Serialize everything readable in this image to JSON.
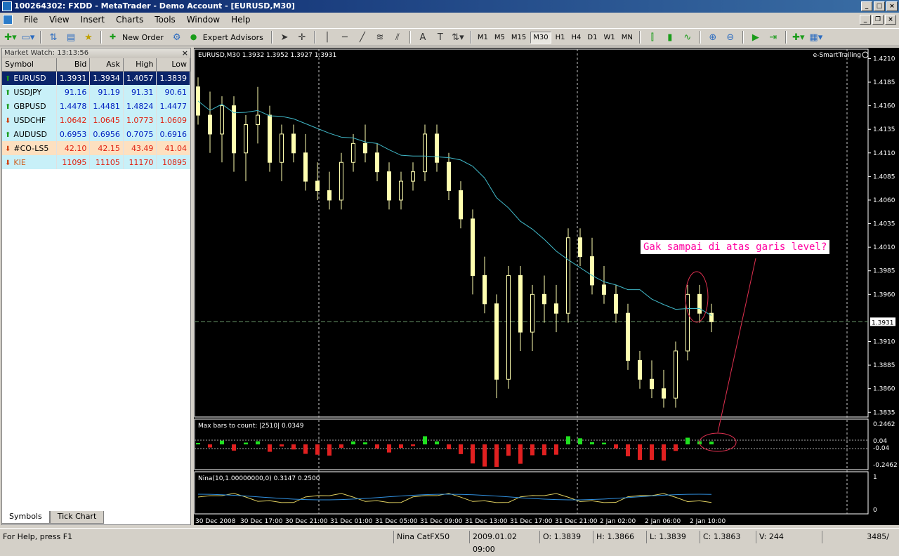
{
  "window": {
    "title": "100264302: FXDD - MetaTrader - Demo Account - [EURUSD,M30]"
  },
  "menu": [
    "File",
    "View",
    "Insert",
    "Charts",
    "Tools",
    "Window",
    "Help"
  ],
  "toolbar": {
    "new_order": "New Order",
    "expert_advisors": "Expert Advisors",
    "timeframes": [
      "M1",
      "M5",
      "M15",
      "M30",
      "H1",
      "H4",
      "D1",
      "W1",
      "MN"
    ],
    "active_timeframe": "M30"
  },
  "market_watch": {
    "title": "Market Watch: 13:13:56",
    "columns": [
      "Symbol",
      "Bid",
      "Ask",
      "High",
      "Low"
    ],
    "rows": [
      {
        "symbol": "EURUSD",
        "bid": "1.3931",
        "ask": "1.3934",
        "high": "1.4057",
        "low": "1.3839",
        "dir": "up"
      },
      {
        "symbol": "USDJPY",
        "bid": "91.16",
        "ask": "91.19",
        "high": "91.31",
        "low": "90.61",
        "dir": "up"
      },
      {
        "symbol": "GBPUSD",
        "bid": "1.4478",
        "ask": "1.4481",
        "high": "1.4824",
        "low": "1.4477",
        "dir": "up"
      },
      {
        "symbol": "USDCHF",
        "bid": "1.0642",
        "ask": "1.0645",
        "high": "1.0773",
        "low": "1.0609",
        "dir": "down"
      },
      {
        "symbol": "AUDUSD",
        "bid": "0.6953",
        "ask": "0.6956",
        "high": "0.7075",
        "low": "0.6916",
        "dir": "up"
      },
      {
        "symbol": "#CO-LS5",
        "bid": "42.10",
        "ask": "42.15",
        "high": "43.49",
        "low": "41.04",
        "dir": "down"
      },
      {
        "symbol": "KIE",
        "bid": "11095",
        "ask": "11105",
        "high": "11170",
        "low": "10895",
        "dir": "down"
      }
    ],
    "tabs": [
      "Symbols",
      "Tick Chart"
    ]
  },
  "chart": {
    "header": "EURUSD,M30  1.3932 1.3952 1.3927 1.3931",
    "ea_label": "e-SmartTrailing",
    "current_price": "1.3931",
    "price_labels": [
      "1.4210",
      "1.4185",
      "1.4160",
      "1.4135",
      "1.4110",
      "1.4085",
      "1.4060",
      "1.4035",
      "1.4010",
      "1.3985",
      "1.3960",
      "1.3910",
      "1.3885",
      "1.3860",
      "1.3835"
    ],
    "callout": "Gak sampai di atas garis level?",
    "indicator1_label": "Max bars to count: |2510|  0.0349",
    "indicator1_scale": [
      "0.2462",
      "0.04",
      "-0.04",
      "-0.2462"
    ],
    "indicator2_label": "Nina(10,1.00000000,0) 0.3147 0.2500",
    "indicator2_scale": [
      "1",
      "0"
    ],
    "time_labels": [
      "30 Dec 2008",
      "30 Dec 17:00",
      "30 Dec 21:00",
      "31 Dec 01:00",
      "31 Dec 05:00",
      "31 Dec 09:00",
      "31 Dec 13:00",
      "31 Dec 17:00",
      "31 Dec 21:00",
      "2 Jan 02:00",
      "2 Jan 06:00",
      "2 Jan 10:00"
    ]
  },
  "chart_data": {
    "type": "candlestick",
    "symbol": "EURUSD",
    "timeframe": "M30",
    "ylim": [
      1.383,
      1.422
    ],
    "candles": [
      [
        1.418,
        1.419,
        1.414,
        1.415
      ],
      [
        1.415,
        1.4175,
        1.411,
        1.413
      ],
      [
        1.413,
        1.417,
        1.41,
        1.416
      ],
      [
        1.416,
        1.417,
        1.409,
        1.411
      ],
      [
        1.411,
        1.415,
        1.408,
        1.414
      ],
      [
        1.414,
        1.418,
        1.412,
        1.415
      ],
      [
        1.415,
        1.416,
        1.409,
        1.41
      ],
      [
        1.41,
        1.414,
        1.408,
        1.413
      ],
      [
        1.413,
        1.414,
        1.41,
        1.411
      ],
      [
        1.411,
        1.413,
        1.407,
        1.408
      ],
      [
        1.408,
        1.41,
        1.406,
        1.407
      ],
      [
        1.407,
        1.409,
        1.405,
        1.406
      ],
      [
        1.406,
        1.411,
        1.405,
        1.41
      ],
      [
        1.41,
        1.413,
        1.409,
        1.412
      ],
      [
        1.412,
        1.414,
        1.41,
        1.411
      ],
      [
        1.411,
        1.412,
        1.408,
        1.409
      ],
      [
        1.409,
        1.41,
        1.405,
        1.406
      ],
      [
        1.406,
        1.409,
        1.405,
        1.408
      ],
      [
        1.408,
        1.41,
        1.407,
        1.409
      ],
      [
        1.409,
        1.414,
        1.408,
        1.413
      ],
      [
        1.413,
        1.414,
        1.409,
        1.41
      ],
      [
        1.41,
        1.411,
        1.406,
        1.407
      ],
      [
        1.407,
        1.408,
        1.403,
        1.404
      ],
      [
        1.404,
        1.405,
        1.396,
        1.398
      ],
      [
        1.398,
        1.4,
        1.394,
        1.395
      ],
      [
        1.395,
        1.396,
        1.385,
        1.387
      ],
      [
        1.387,
        1.399,
        1.386,
        1.398
      ],
      [
        1.398,
        1.399,
        1.39,
        1.392
      ],
      [
        1.392,
        1.397,
        1.39,
        1.396
      ],
      [
        1.396,
        1.398,
        1.393,
        1.395
      ],
      [
        1.395,
        1.397,
        1.392,
        1.394
      ],
      [
        1.394,
        1.403,
        1.393,
        1.402
      ],
      [
        1.402,
        1.403,
        1.399,
        1.4
      ],
      [
        1.4,
        1.402,
        1.396,
        1.397
      ],
      [
        1.397,
        1.399,
        1.395,
        1.396
      ],
      [
        1.396,
        1.397,
        1.393,
        1.394
      ],
      [
        1.394,
        1.395,
        1.388,
        1.389
      ],
      [
        1.389,
        1.39,
        1.386,
        1.387
      ],
      [
        1.387,
        1.389,
        1.385,
        1.386
      ],
      [
        1.386,
        1.388,
        1.384,
        1.385
      ],
      [
        1.385,
        1.391,
        1.384,
        1.39
      ],
      [
        1.39,
        1.397,
        1.389,
        1.396
      ],
      [
        1.396,
        1.397,
        1.393,
        1.394
      ],
      [
        1.394,
        1.395,
        1.392,
        1.3931
      ]
    ]
  },
  "statusbar": {
    "help": "For Help, press F1",
    "profile": "Nina CatFX50",
    "datetime": "2009.01.02 09:00",
    "open": "O: 1.3839",
    "high": "H: 1.3866",
    "low": "L: 1.3839",
    "close": "C: 1.3863",
    "volume": "V: 244",
    "traffic": "3485/"
  },
  "colors": {
    "candle": "#ffffb0",
    "ma": "#40b8c8",
    "bull_hist": "#20e020",
    "bear_hist": "#e02020",
    "callout_text": "#ff00a0"
  }
}
